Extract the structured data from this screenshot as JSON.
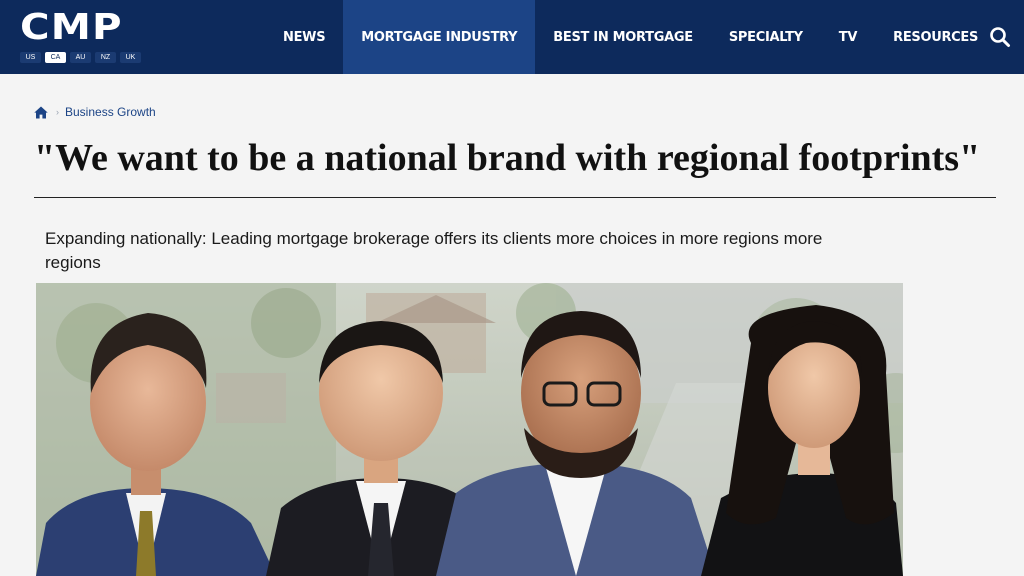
{
  "header": {
    "logo": "CMP",
    "regions": [
      "US",
      "CA",
      "AU",
      "NZ",
      "UK"
    ],
    "active_region": "CA",
    "nav": [
      {
        "label": "NEWS",
        "active": false
      },
      {
        "label": "MORTGAGE INDUSTRY",
        "active": true
      },
      {
        "label": "BEST IN MORTGAGE",
        "active": false
      },
      {
        "label": "SPECIALTY",
        "active": false
      },
      {
        "label": "TV",
        "active": false
      },
      {
        "label": "RESOURCES",
        "active": false
      }
    ],
    "search_icon": "search-icon"
  },
  "breadcrumb": {
    "home_icon": "home-icon",
    "category": "Business Growth"
  },
  "article": {
    "headline": "\"We want to be a national brand with regional footprints\"",
    "subheading": "Expanding nationally: Leading mortgage brokerage offers its clients more choices in more regions more regions"
  },
  "colors": {
    "nav_bg": "#0d2a5c",
    "nav_active": "#1c4486",
    "link": "#1c4486",
    "page_bg": "#f4f4f4"
  }
}
